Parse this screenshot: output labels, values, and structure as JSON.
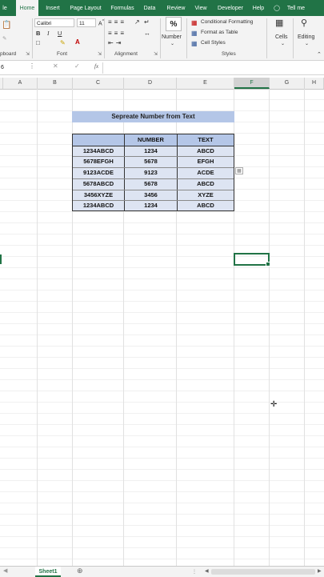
{
  "ribbon_tabs": [
    {
      "label": "le",
      "active": false
    },
    {
      "label": "Home",
      "active": true
    },
    {
      "label": "Insert",
      "active": false
    },
    {
      "label": "Page Layout",
      "active": false
    },
    {
      "label": "Formulas",
      "active": false
    },
    {
      "label": "Data",
      "active": false
    },
    {
      "label": "Review",
      "active": false
    },
    {
      "label": "View",
      "active": false
    },
    {
      "label": "Developer",
      "active": false
    },
    {
      "label": "Help",
      "active": false
    }
  ],
  "tell_me": "Tell me",
  "font": {
    "name": "Calibri",
    "size": "11"
  },
  "number_label": "Number",
  "styles": {
    "conditional": "Conditional Formatting",
    "format_table": "Format as Table",
    "cell_styles": "Cell Styles"
  },
  "cells_label": "Cells",
  "editing_label": "Editing",
  "group_labels": {
    "clipboard": "pboard",
    "font": "Font",
    "alignment": "Alignment",
    "styles": "Styles"
  },
  "namebox": "6",
  "fx": "fx",
  "columns": [
    "A",
    "B",
    "C",
    "D",
    "E",
    "F",
    "G",
    "H"
  ],
  "table": {
    "title": "Sepreate Number from Text",
    "headers": [
      "",
      "NUMBER",
      "TEXT"
    ],
    "rows": [
      [
        "1234ABCD",
        "1234",
        "ABCD"
      ],
      [
        "5678EFGH",
        "5678",
        "EFGH"
      ],
      [
        "9123ACDE",
        "9123",
        "ACDE"
      ],
      [
        "5678ABCD",
        "5678",
        "ABCD"
      ],
      [
        "3456XYZE",
        "3456",
        "XYZE"
      ],
      [
        "1234ABCD",
        "1234",
        "ABCD"
      ]
    ]
  },
  "sheet_tab": "Sheet1",
  "colors": {
    "accent": "#217346",
    "table_fill": "#b4c6e7",
    "table_body": "#dde4f2"
  }
}
